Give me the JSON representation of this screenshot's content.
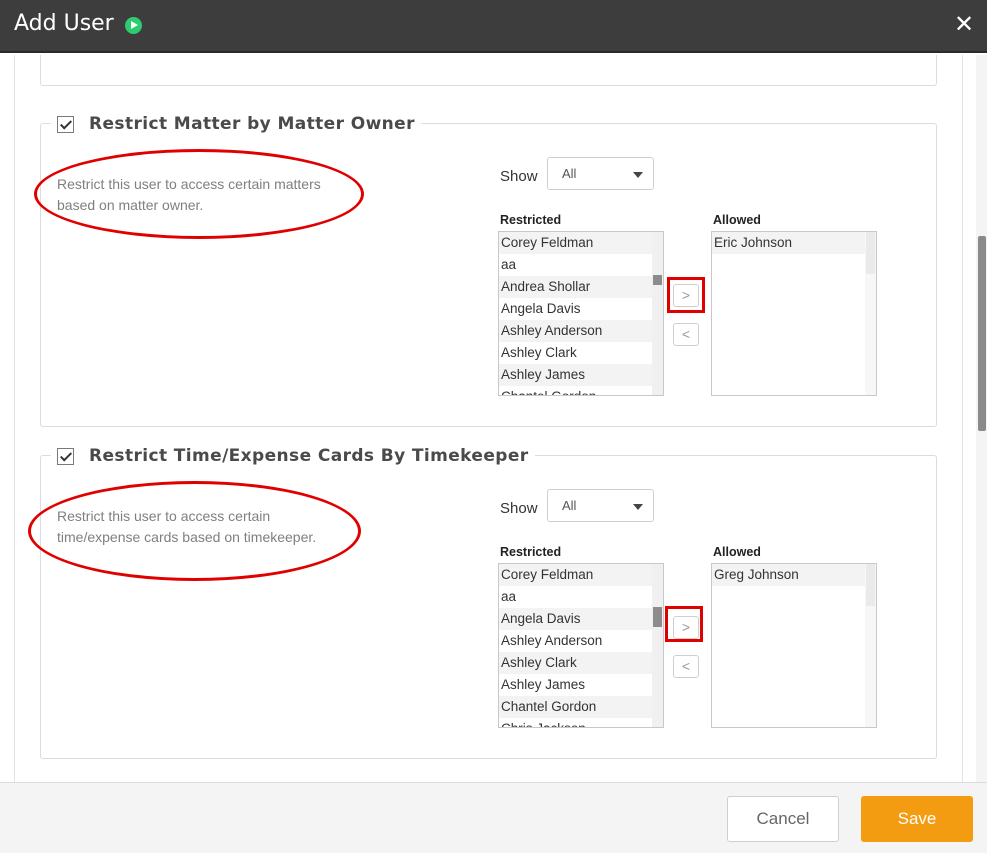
{
  "header": {
    "title": "Add User",
    "close_glyph": "✕"
  },
  "sections": [
    {
      "checked": true,
      "title": "Restrict Matter by Matter Owner",
      "description": "Restrict this user to access certain matters based on matter owner.",
      "show_label": "Show",
      "show_value": "All",
      "restricted_label": "Restricted",
      "allowed_label": "Allowed",
      "restricted": [
        "Corey Feldman",
        "aa",
        "Andrea Shollar",
        "Angela Davis",
        "Ashley Anderson",
        "Ashley Clark",
        "Ashley James",
        "Chantel Gordon"
      ],
      "allowed": [
        "Eric Johnson"
      ],
      "move_right": ">",
      "move_left": "<"
    },
    {
      "checked": true,
      "title": "Restrict Time/Expense Cards By Timekeeper",
      "description": "Restrict this user to access certain time/expense cards based on timekeeper.",
      "show_label": "Show",
      "show_value": "All",
      "restricted_label": "Restricted",
      "allowed_label": "Allowed",
      "restricted": [
        "Corey Feldman",
        "aa",
        "Angela Davis",
        "Ashley Anderson",
        "Ashley Clark",
        "Ashley James",
        "Chantel Gordon",
        "Chris Jackson"
      ],
      "allowed": [
        "Greg Johnson"
      ],
      "move_right": ">",
      "move_left": "<"
    }
  ],
  "footer": {
    "cancel_label": "Cancel",
    "save_label": "Save"
  },
  "colors": {
    "header_bg": "#3d3d3d",
    "annotation_red": "#e00000",
    "save_orange": "#f39c12",
    "play_green": "#2ecc71"
  },
  "icons": [
    "play-icon",
    "close-icon",
    "checkbox-checked-icon",
    "caret-down-icon"
  ]
}
